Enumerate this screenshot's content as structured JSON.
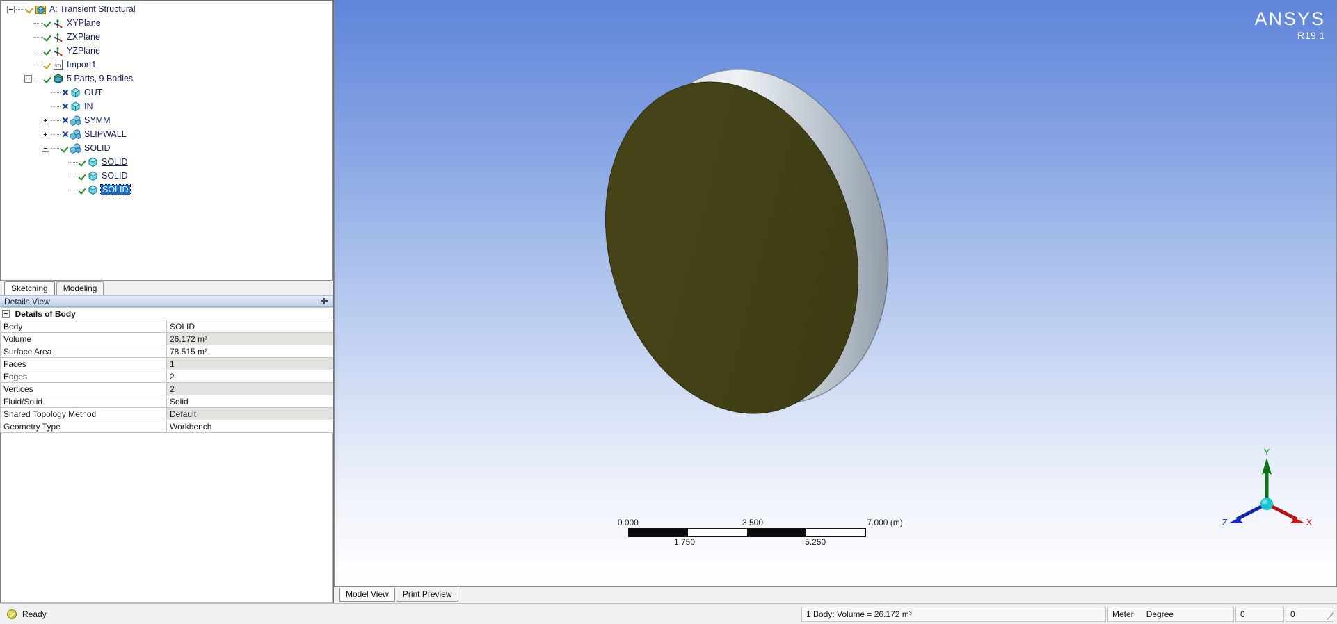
{
  "tree": {
    "items": [
      {
        "label": "A: Transient Structural",
        "indent": 0,
        "expander": "minus",
        "mark": "checkgold",
        "icon": "project-icon"
      },
      {
        "label": "XYPlane",
        "indent": 1,
        "expander": "none",
        "mark": "check",
        "icon": "plane-icon"
      },
      {
        "label": "ZXPlane",
        "indent": 1,
        "expander": "none",
        "mark": "check",
        "icon": "plane-icon"
      },
      {
        "label": "YZPlane",
        "indent": 1,
        "expander": "none",
        "mark": "check",
        "icon": "plane-icon"
      },
      {
        "label": "Import1",
        "indent": 1,
        "expander": "none",
        "mark": "checkgold",
        "icon": "stl-import-icon"
      },
      {
        "label": "5 Parts, 9 Bodies",
        "indent": 1,
        "expander": "minus",
        "mark": "check",
        "icon": "parts-icon"
      },
      {
        "label": "OUT",
        "indent": 2,
        "expander": "none",
        "mark": "cross",
        "icon": "body-icon"
      },
      {
        "label": "IN",
        "indent": 2,
        "expander": "none",
        "mark": "cross",
        "icon": "body-icon"
      },
      {
        "label": "SYMM",
        "indent": 2,
        "expander": "plus",
        "mark": "cross",
        "icon": "part-icon"
      },
      {
        "label": "SLIPWALL",
        "indent": 2,
        "expander": "plus",
        "mark": "cross",
        "icon": "part-icon"
      },
      {
        "label": "SOLID",
        "indent": 2,
        "expander": "minus",
        "mark": "check",
        "icon": "part-icon"
      },
      {
        "label": "SOLID",
        "indent": 3,
        "expander": "none",
        "mark": "check",
        "icon": "body-icon",
        "style": "underline"
      },
      {
        "label": "SOLID",
        "indent": 3,
        "expander": "none",
        "mark": "check",
        "icon": "body-icon"
      },
      {
        "label": "SOLID",
        "indent": 3,
        "expander": "none",
        "mark": "check",
        "icon": "body-icon",
        "style": "selected"
      }
    ]
  },
  "sketch_tabs": {
    "sketching": "Sketching",
    "modeling": "Modeling"
  },
  "details": {
    "title": "Details View",
    "group_label": "Details of Body",
    "rows": [
      {
        "key": "Body",
        "value": "SOLID"
      },
      {
        "key": "Volume",
        "value": "26.172 m³"
      },
      {
        "key": "Surface Area",
        "value": "78.515 m²"
      },
      {
        "key": "Faces",
        "value": "1"
      },
      {
        "key": "Edges",
        "value": "2"
      },
      {
        "key": "Vertices",
        "value": "2"
      },
      {
        "key": "Fluid/Solid",
        "value": "Solid"
      },
      {
        "key": "Shared Topology Method",
        "value": "Default"
      },
      {
        "key": "Geometry Type",
        "value": "Workbench"
      }
    ]
  },
  "graphics": {
    "logo_main": "ANSYS",
    "logo_rev": "R19.1",
    "ruler": {
      "ticks_top": [
        "0.000",
        "3.500",
        "7.000 (m)"
      ],
      "ticks_bottom": [
        "1.750",
        "5.250"
      ]
    },
    "triad": {
      "x_label": "X",
      "y_label": "Y",
      "z_label": "Z"
    }
  },
  "view_tabs": {
    "model_view": "Model View",
    "print_preview": "Print Preview"
  },
  "status": {
    "ready": "Ready",
    "selection_info": "1 Body: Volume = 26.172 m³",
    "unit_length": "Meter",
    "unit_angle": "Degree",
    "counter1": "0",
    "counter2": "0"
  },
  "colors": {
    "selection_highlight": "#1568c8",
    "body_face": "#43411a",
    "background_top": "#5e85da",
    "axis_x": "#c01717",
    "axis_y": "#0b7a13",
    "axis_z": "#1a2fc0"
  }
}
